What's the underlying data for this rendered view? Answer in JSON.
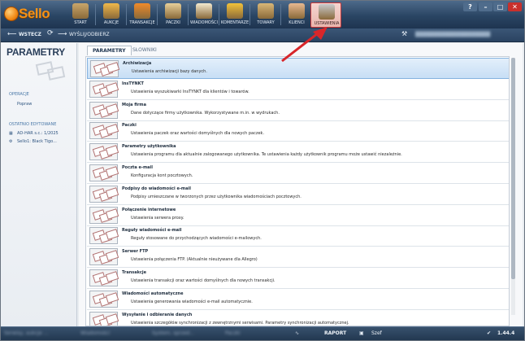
{
  "app": {
    "logo_text": "Sello"
  },
  "toolbar": [
    {
      "id": "start",
      "label": "START",
      "color": "#c9a66b"
    },
    {
      "id": "aukcje",
      "label": "AUKCJE",
      "color": "#f0b84a"
    },
    {
      "id": "transakcje",
      "label": "TRANSAKCJE",
      "color": "#f08a2a"
    },
    {
      "id": "paczki",
      "label": "PACZKI",
      "color": "#e8d09a"
    },
    {
      "id": "wiadomosci",
      "label": "WIADOMOŚCI",
      "color": "#f4ead0"
    },
    {
      "id": "komentarze",
      "label": "KOMENTARZE",
      "color": "#f2c23a"
    },
    {
      "id": "towary",
      "label": "TOWARY",
      "color": "#d9b777"
    },
    {
      "id": "klienci",
      "label": "KLIENCI",
      "color": "#e8b890"
    },
    {
      "id": "ustawienia",
      "label": "USTAWIENIA",
      "color": "#c7c9cc"
    }
  ],
  "window_controls": {
    "help": "?",
    "minimize": "–",
    "maximize": "□",
    "close": "✕"
  },
  "nav": {
    "back_label": "WSTECZ",
    "refresh_icon": "refresh-icon",
    "forward_icon": "forward-icon",
    "breadcrumb": "WYŚLIJ/ODBIERZ",
    "user_text": "blurred account name",
    "tools_icon": "tools-icon"
  },
  "sidebar": {
    "title": "PARAMETRY",
    "sections": [
      {
        "label": "OPERACJE",
        "items": [
          "Popraw"
        ]
      },
      {
        "label": "OSTATNIO EDYTOWANE",
        "items": [
          "AD-HAR s.c.: 1/2025",
          "Sello1: Black Tigo..."
        ]
      }
    ]
  },
  "tabs": [
    {
      "label": "PARAMETRY",
      "active": true
    },
    {
      "label": "SŁOWNIKI",
      "active": false
    }
  ],
  "settings": [
    {
      "name": "Archiwizacja",
      "desc": "Ustawienia archiwizacji bazy danych.",
      "selected": true
    },
    {
      "name": "InsTYNKT",
      "desc": "Ustawienia wyszukiwarki InsTYNKT dla klientów i towarów."
    },
    {
      "name": "Moja firma",
      "desc": "Dane dotyczące firmy użytkownika. Wykorzystywane m.in. w wydrukach."
    },
    {
      "name": "Paczki",
      "desc": "Ustawienia paczek oraz wartości domyślnych dla nowych paczek."
    },
    {
      "name": "Parametry użytkownika",
      "desc": "Ustawienia programu dla aktualnie zalogowanego użytkownika. Te ustawienia każdy użytkownik programu może ustawić niezależnie."
    },
    {
      "name": "Poczta e-mail",
      "desc": "Konfiguracja kont pocztowych."
    },
    {
      "name": "Podpisy do wiadomości e-mail",
      "desc": "Podpisy umieszczane w tworzonych przez użytkownika wiadomościach pocztowych."
    },
    {
      "name": "Połączenie internetowe",
      "desc": "Ustawienia serwera proxy."
    },
    {
      "name": "Reguły wiadomości e-mail",
      "desc": "Reguły stosowane do przychodzących wiadomości e-mailowych."
    },
    {
      "name": "Serwer FTP",
      "desc": "Ustawienia połączenia FTP. (Aktualnie nieużywane dla Allegro)"
    },
    {
      "name": "Transakcje",
      "desc": "Ustawienia transakcji oraz wartości domyślnych dla nowych transakcji."
    },
    {
      "name": "Wiadomości automatyczne",
      "desc": "Ustawienia generowania wiadomości e-mail automatycznie."
    },
    {
      "name": "Wysyłanie i odbieranie danych",
      "desc": "Ustawienia szczegółów synchronizacji z zewnętrznymi serwisami. Parametry synchronizacji automatycznej."
    }
  ],
  "status": {
    "items": [
      "Serwisy, aukcje ...",
      "Wiadomości",
      "System, sprzed...",
      "Paczki"
    ],
    "raport": "RAPORT",
    "user": "Szef",
    "version": "1.44.4"
  },
  "colors": {
    "accent_red": "#d8262a",
    "selection": "#c7def5",
    "ribbon": "#2a4563"
  }
}
